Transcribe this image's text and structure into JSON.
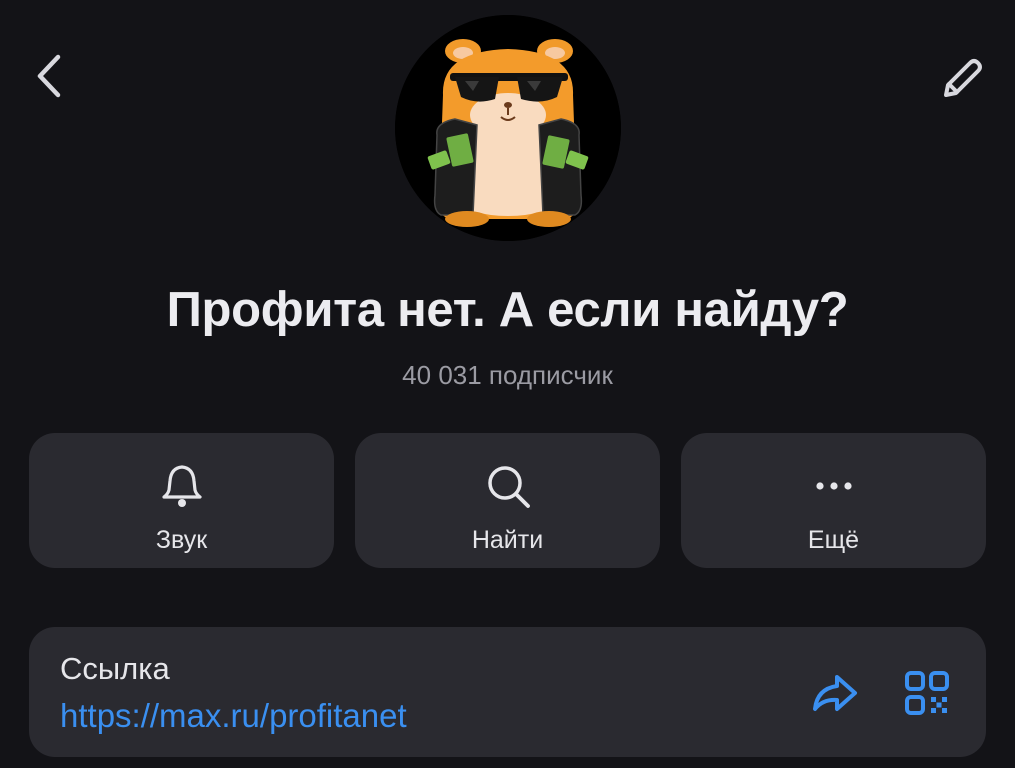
{
  "header": {
    "back_icon": "chevron-left-icon",
    "edit_icon": "pencil-icon"
  },
  "channel": {
    "avatar_icon": "hamster-sunglasses-avatar",
    "title": "Профита нет. А если найду?",
    "subscribers": "40 031 подписчик"
  },
  "actions": [
    {
      "label": "Звук",
      "icon": "bell-icon"
    },
    {
      "label": "Найти",
      "icon": "search-icon"
    },
    {
      "label": "Ещё",
      "icon": "more-dots-icon"
    }
  ],
  "link": {
    "label": "Ссылка",
    "url": "https://max.ru/profitanet",
    "share_icon": "share-arrow-icon",
    "qr_icon": "qr-code-icon"
  },
  "colors": {
    "background": "#131317",
    "card": "#2a2a30",
    "accent": "#3a8ff0",
    "text_primary": "#ececf0",
    "text_secondary": "#9b9ba3"
  }
}
